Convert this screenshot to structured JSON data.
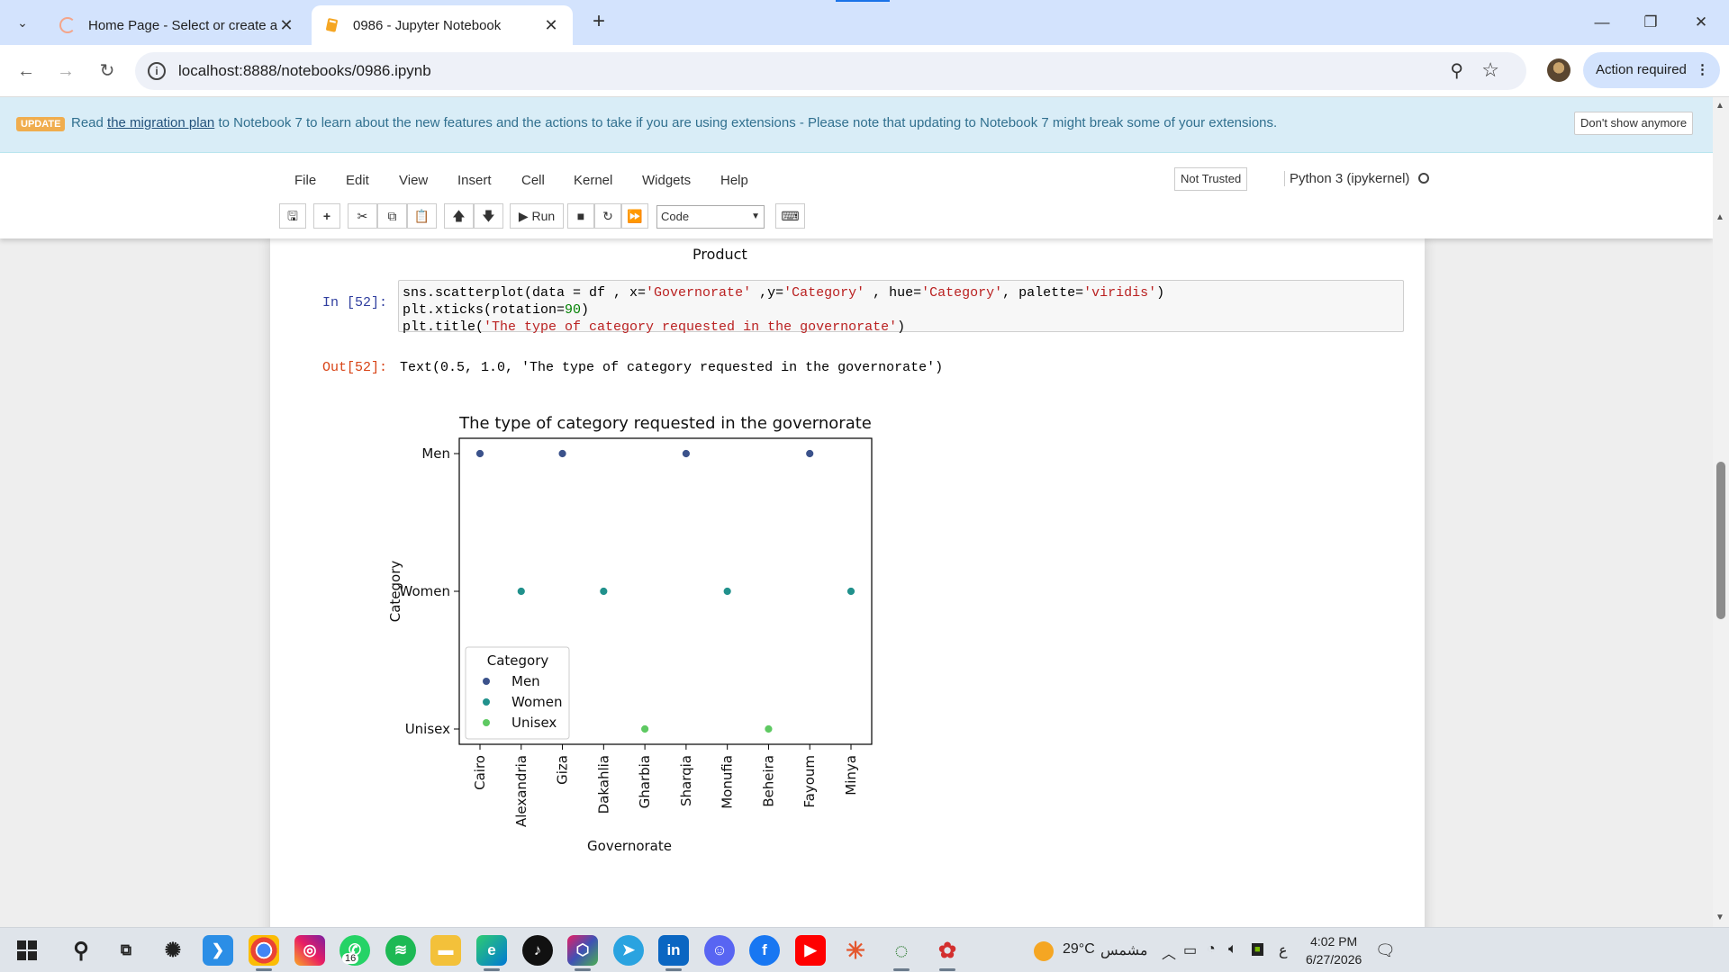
{
  "browser": {
    "tabs": [
      {
        "title": "Home Page - Select or create a",
        "active": false
      },
      {
        "title": "0986 - Jupyter Notebook",
        "active": true
      }
    ],
    "url": "localhost:8888/notebooks/0986.ipynb",
    "action_required": "Action required"
  },
  "banner": {
    "badge": "UPDATE",
    "pre": "Read ",
    "link": "the migration plan",
    "post": " to Notebook 7 to learn about the new features and the actions to take if you are using extensions - Please note that updating to Notebook 7 might break some of your extensions.",
    "dismiss": "Don't show anymore"
  },
  "menu": [
    "File",
    "Edit",
    "View",
    "Insert",
    "Cell",
    "Kernel",
    "Widgets",
    "Help"
  ],
  "trust": "Not Trusted",
  "kernel": "Python 3 (ipykernel)",
  "toolbar": {
    "run": "Run",
    "cell_type": "Code"
  },
  "notebook": {
    "prev_output_label": "Product",
    "cell": {
      "in_prompt": "In [52]:",
      "out_prompt": "Out[52]:",
      "output_text": "Text(0.5, 1.0, 'The type of category requested in the governorate')"
    }
  },
  "chart_data": {
    "type": "scatter",
    "title": "The type of category requested in the governorate",
    "xlabel": "Governorate",
    "ylabel": "Category",
    "x_categories": [
      "Cairo",
      "Alexandria",
      "Giza",
      "Dakahlia",
      "Gharbia",
      "Sharqia",
      "Monufia",
      "Beheira",
      "Fayoum",
      "Minya"
    ],
    "y_categories": [
      "Men",
      "Women",
      "Unisex"
    ],
    "legend": {
      "title": "Category",
      "position": "lower-left"
    },
    "series": [
      {
        "name": "Men",
        "color": "#3b528b",
        "x": [
          "Cairo",
          "Giza",
          "Sharqia",
          "Fayoum"
        ]
      },
      {
        "name": "Women",
        "color": "#21918c",
        "x": [
          "Alexandria",
          "Dakahlia",
          "Monufia",
          "Minya"
        ]
      },
      {
        "name": "Unisex",
        "color": "#5ec962",
        "x": [
          "Gharbia",
          "Beheira"
        ]
      }
    ]
  },
  "taskbar": {
    "weather": "29°C",
    "weather_desc": "مشمس",
    "lang": "ع",
    "time": "4:02 PM",
    "date": "6/27/2026",
    "whatsapp_badge": "16"
  }
}
